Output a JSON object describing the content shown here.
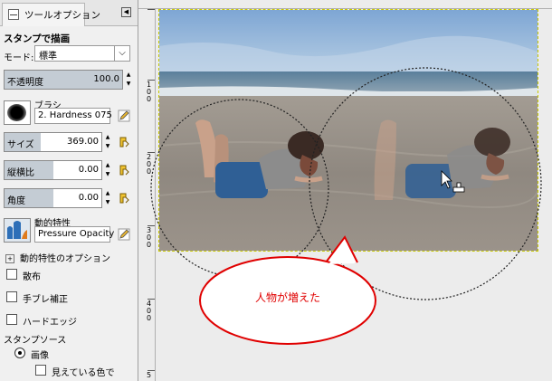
{
  "panel": {
    "tab_label": "ツールオプション",
    "tool_title": "スタンプで描画",
    "mode_label": "モード:",
    "mode_value": "標準",
    "opacity": {
      "label": "不透明度",
      "value": "100.0",
      "fraction": 1.0
    },
    "brush": {
      "label": "ブラシ",
      "name": "2. Hardness 075"
    },
    "size": {
      "label": "サイズ",
      "value": "369.00",
      "fraction": 0.37
    },
    "aspect": {
      "label": "縦横比",
      "value": "0.00",
      "fraction": 0.5
    },
    "angle": {
      "label": "角度",
      "value": "0.00",
      "fraction": 0.5
    },
    "dynamics": {
      "label": "動的特性",
      "name": "Pressure Opacity",
      "options_label": "動的特性のオプション"
    },
    "checkboxes": [
      {
        "label": "散布"
      },
      {
        "label": "手ブレ補正"
      },
      {
        "label": "ハードエッジ"
      }
    ],
    "source": {
      "title": "スタンプソース",
      "radio_label": "画像",
      "sample_label": "見えている色で"
    }
  },
  "ruler": {
    "v_labels": [
      [
        "1",
        "0",
        "0"
      ],
      [
        "2",
        "0",
        "0"
      ],
      [
        "3",
        "0",
        "0"
      ],
      [
        "4",
        "0",
        "0"
      ],
      [
        "5"
      ]
    ]
  },
  "callout": {
    "text": "人物が増えた",
    "color": "#e00000"
  },
  "colors": {
    "accent": "#e00000",
    "selection": "#c8c800",
    "panel": "#f0f0f0"
  }
}
